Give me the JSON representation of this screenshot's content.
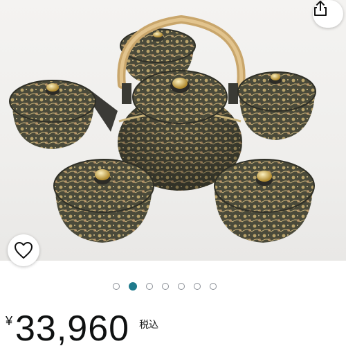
{
  "product": {
    "price_currency": "¥",
    "price_amount": "33,960",
    "tax_label": "税込"
  },
  "carousel": {
    "total_images": 7,
    "active_index": 1
  },
  "icons": {
    "share": "share-icon",
    "favorite": "heart-icon"
  },
  "colors": {
    "active_dot": "#1f7a8c",
    "inactive_dot": "#8a8f96"
  }
}
